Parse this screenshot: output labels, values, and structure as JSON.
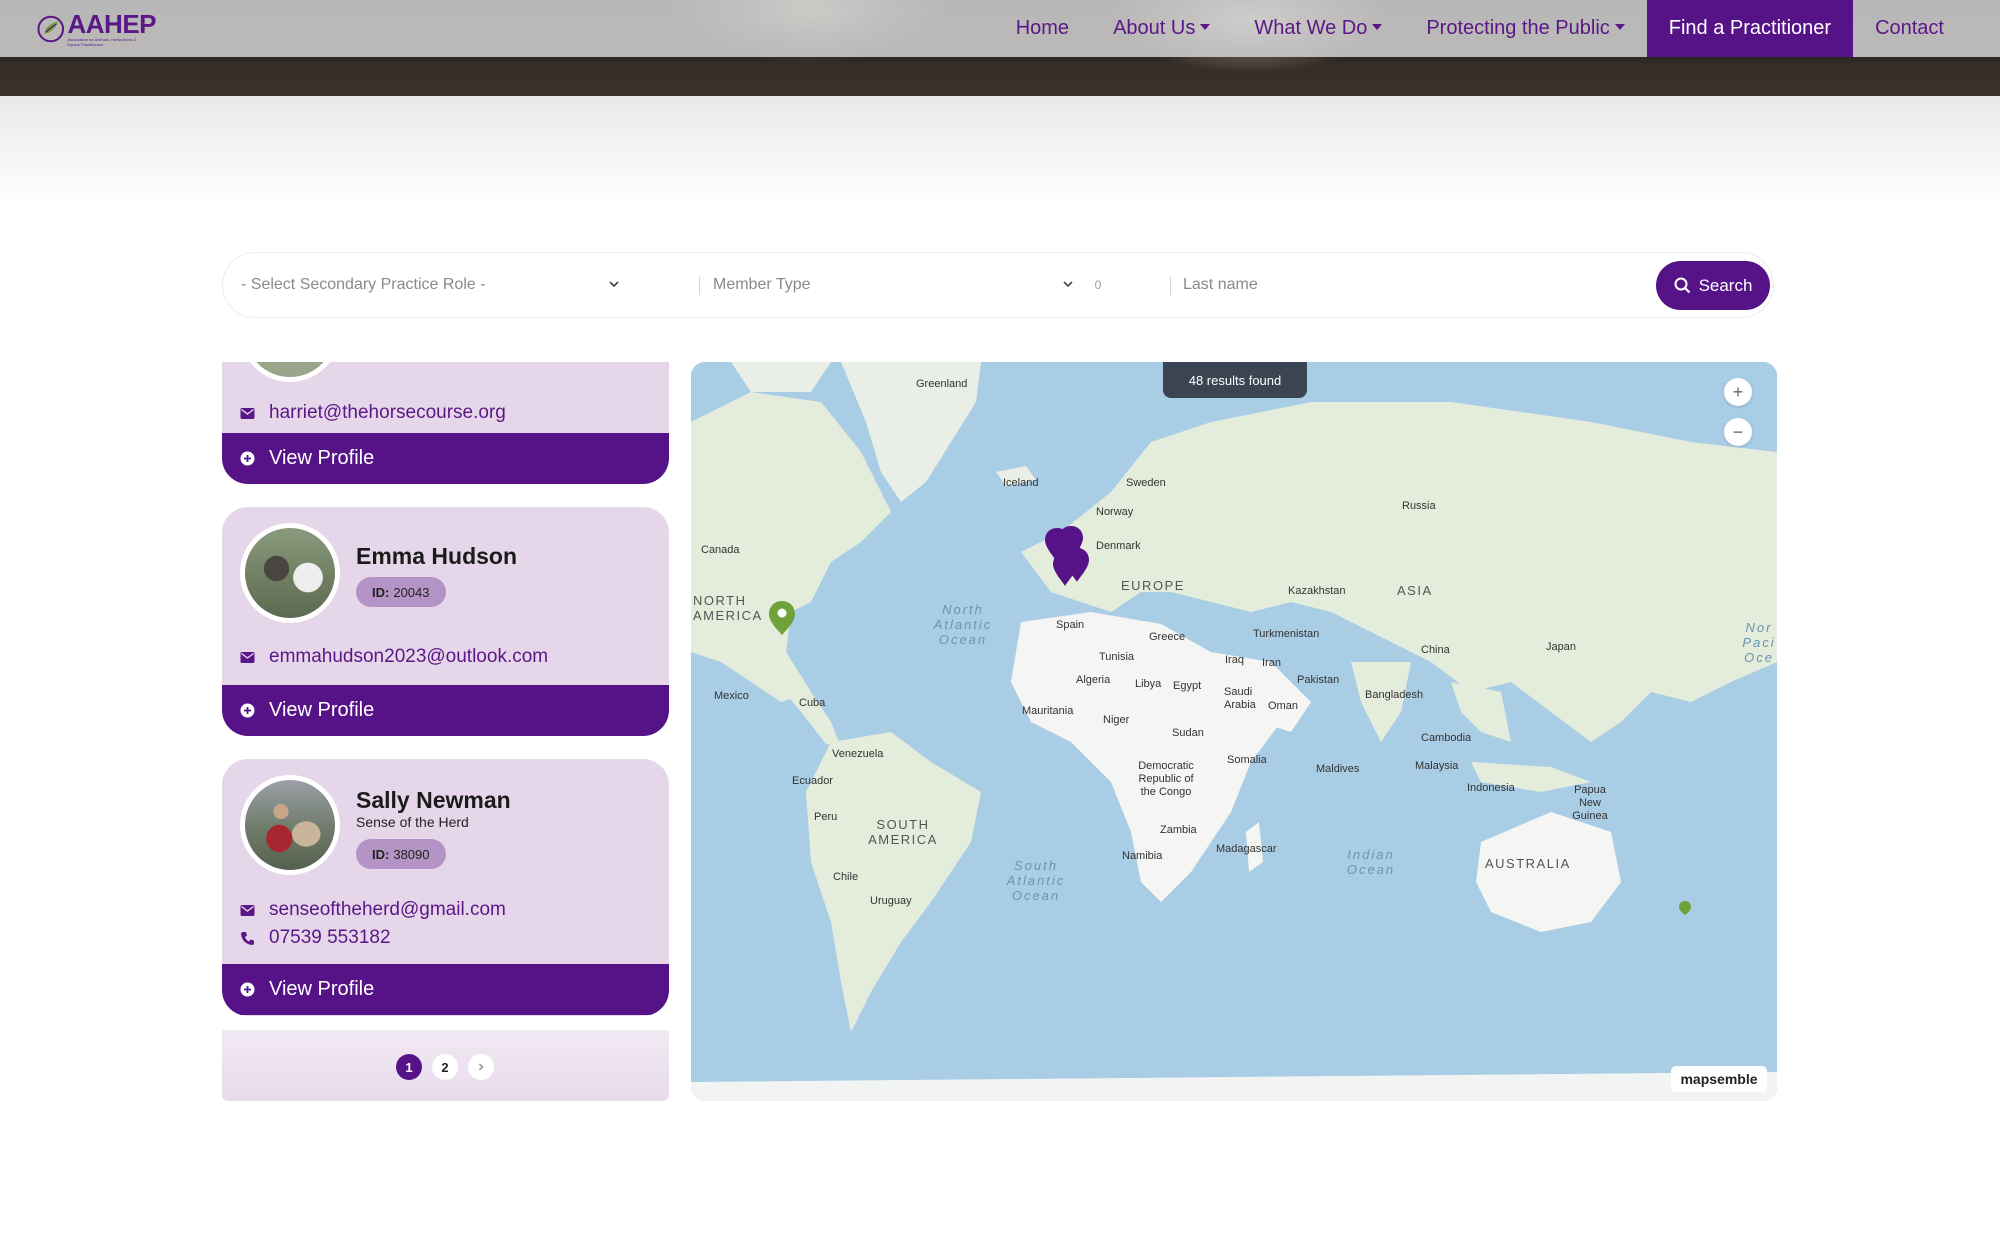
{
  "nav": {
    "logo_text": "AAHEP",
    "logo_subtitle": "Association for Animals, Horticultural & Equine Practitioners",
    "items": [
      {
        "label": "Home",
        "dropdown": false
      },
      {
        "label": "About Us",
        "dropdown": true
      },
      {
        "label": "What We Do",
        "dropdown": true
      },
      {
        "label": "Protecting the Public",
        "dropdown": true
      },
      {
        "label": "Find a Practitioner",
        "dropdown": false,
        "active": true
      },
      {
        "label": "Contact",
        "dropdown": false
      }
    ]
  },
  "search": {
    "secondary_role_placeholder": "- Select Secondary Practice Role -",
    "member_type_placeholder": "Member Type",
    "member_type_count": "0",
    "lastname_placeholder": "Last name",
    "button_label": "Search"
  },
  "practitioners": [
    {
      "name": "",
      "email": "harriet@thehorsecourse.org",
      "view_label": "View Profile"
    },
    {
      "name": "Emma Hudson",
      "id_label": "ID:",
      "id": "20043",
      "email": "emmahudson2023@outlook.com",
      "view_label": "View Profile"
    },
    {
      "name": "Sally Newman",
      "org": "Sense of the Herd",
      "id_label": "ID:",
      "id": "38090",
      "email": "senseoftheherd@gmail.com",
      "phone": "07539 553182",
      "view_label": "View Profile"
    }
  ],
  "pagination": {
    "current": "1",
    "next_page": "2",
    "next_icon": "chevron-right-icon"
  },
  "map": {
    "results": "48 results found",
    "zoom_in": "+",
    "zoom_out": "−",
    "brand": "mapsemble",
    "labels": {
      "greenland": "Greenland",
      "iceland": "Iceland",
      "sweden": "Sweden",
      "norway": "Norway",
      "russia": "Russia",
      "canada": "Canada",
      "denmark": "Denmark",
      "europe": "EUROPE",
      "kazakhstan": "Kazakhstan",
      "asia": "ASIA",
      "north_america": "NORTH AMERICA",
      "north_atlantic": "North Atlantic Ocean",
      "spain": "Spain",
      "greece": "Greece",
      "turkmenistan": "Turkmenistan",
      "china": "China",
      "japan": "Japan",
      "north_pacific": "Nor Paci Oce",
      "tunisia": "Tunisia",
      "iraq": "Iraq",
      "iran": "Iran",
      "pakistan": "Pakistan",
      "mexico": "Mexico",
      "cuba": "Cuba",
      "algeria": "Algeria",
      "libya": "Libya",
      "egypt": "Egypt",
      "saudi_arabia": "Saudi Arabia",
      "oman": "Oman",
      "bangladesh": "Bangladesh",
      "mauritania": "Mauritania",
      "niger": "Niger",
      "sudan": "Sudan",
      "cambodia": "Cambodia",
      "venezuela": "Venezuela",
      "somalia": "Somalia",
      "maldives": "Maldives",
      "malaysia": "Malaysia",
      "ecuador": "Ecuador",
      "drc": "Democratic Republic of the Congo",
      "indonesia": "Indonesia",
      "png": "Papua New Guinea",
      "peru": "Peru",
      "south_america": "SOUTH AMERICA",
      "zambia": "Zambia",
      "madagascar": "Madagascar",
      "indian_ocean": "Indian Ocean",
      "namibia": "Namibia",
      "australia": "AUSTRALIA",
      "chile": "Chile",
      "south_atlantic": "South Atlantic Ocean",
      "uruguay": "Uruguay"
    },
    "colors": {
      "brand_purple": "#561388",
      "marker_green": "#6fa33a",
      "ocean": "#a9cde4",
      "land": "#e4eddc"
    }
  }
}
